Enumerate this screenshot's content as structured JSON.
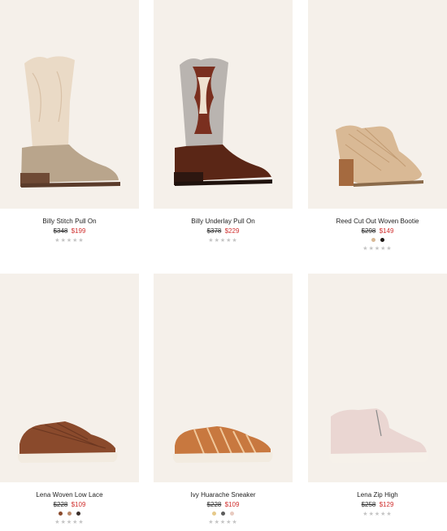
{
  "products": [
    {
      "name": "Billy Stitch Pull On",
      "original_price": "$348",
      "sale_price": "$199",
      "swatches": [],
      "rating_stars": "★★★★★",
      "rating_value": 0
    },
    {
      "name": "Billy Underlay Pull On",
      "original_price": "$378",
      "sale_price": "$229",
      "swatches": [],
      "rating_stars": "★★★★★",
      "rating_value": 0
    },
    {
      "name": "Reed Cut Out Woven Bootie",
      "original_price": "$298",
      "sale_price": "$149",
      "swatches": [
        "#d9b995",
        "#1f1a17"
      ],
      "rating_stars": "★★★★★",
      "rating_value": 0
    },
    {
      "name": "Lena Woven Low Lace",
      "original_price": "$228",
      "sale_price": "$109",
      "swatches": [
        "#8a4a2c",
        "#b9886a",
        "#3a2e2a"
      ],
      "rating_stars": "★★★★★",
      "rating_value": 0
    },
    {
      "name": "Ivy Huarache Sneaker",
      "original_price": "$228",
      "sale_price": "$109",
      "swatches": [
        "#e6c98a",
        "#5c5c5c",
        "#e8cbc0"
      ],
      "rating_stars": "★★★★★",
      "rating_value": 0
    },
    {
      "name": "Lena Zip High",
      "original_price": "$258",
      "sale_price": "$129",
      "swatches": [],
      "rating_stars": "★★★★★",
      "rating_value": 0
    }
  ],
  "colors": {
    "image_bg": "#f5f0ea",
    "sale": "#d0302f",
    "star_empty": "#c4c4c4"
  }
}
